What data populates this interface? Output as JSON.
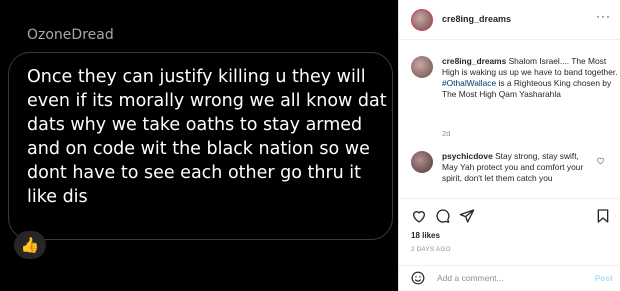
{
  "message_image": {
    "username": "OzoneDread",
    "text": "Once they can justify killing u they will even if its morally wrong we all know dat dats why we take oaths to stay armed and on code wit the black nation so we dont have to see each other go thru it like dis",
    "reaction": "👍"
  },
  "post": {
    "header_username": "cre8ing_dreams",
    "more_label": "···",
    "caption": {
      "username": "cre8ing_dreams",
      "text_before": "Shalom Israel.... The Most High is waking us up we have to band together.",
      "hashtag": "#OthalWallace",
      "text_after": "is a Righteous King chosen by The Most High Qam Yasharahla",
      "age": "2d"
    },
    "comment": {
      "username": "psychicdove",
      "text": "Stay strong, stay swift, May Yah protect you and comfort your spirit, don't let them catch you"
    },
    "likes": "18 likes",
    "date": "2 DAYS AGO",
    "add_comment_placeholder": "Add a comment...",
    "post_label": "Post"
  },
  "icons": [
    "heart-icon",
    "comment-icon",
    "share-icon",
    "bookmark-icon",
    "emoji-icon",
    "thumbs-up-icon",
    "more-icon"
  ]
}
